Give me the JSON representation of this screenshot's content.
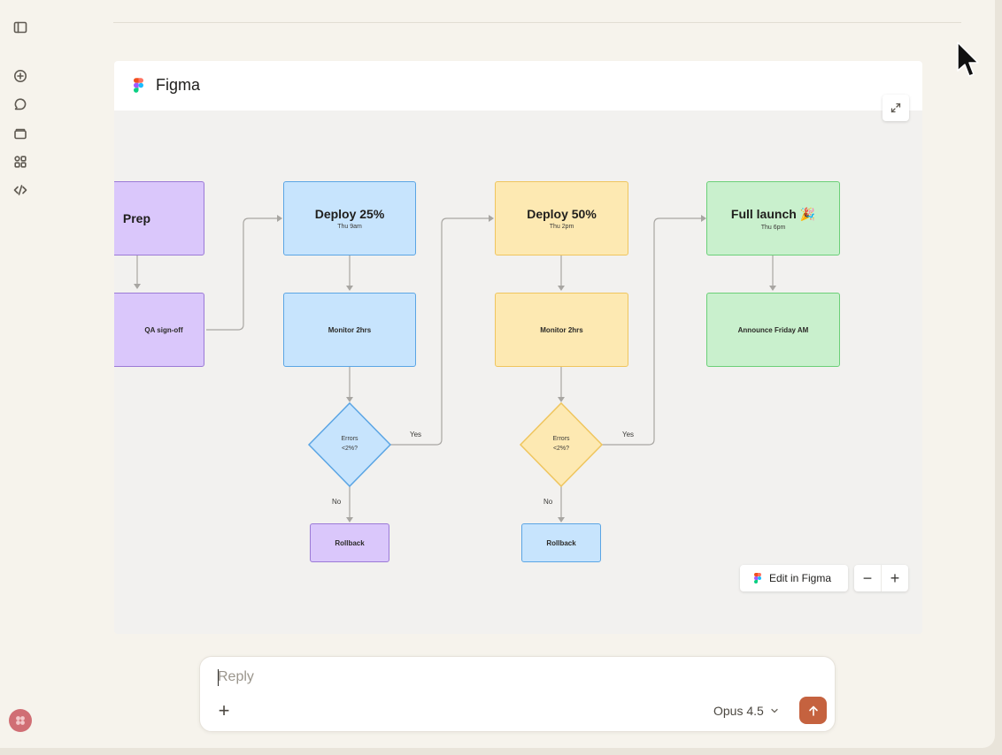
{
  "artifact": {
    "title": "Figma",
    "edit_label": "Edit in Figma",
    "zoom_out_label": "−",
    "zoom_in_label": "+"
  },
  "flowchart": {
    "prep": {
      "title": "Prep"
    },
    "qa": {
      "label": "QA sign-off"
    },
    "stage1": {
      "title": "Deploy 25%",
      "time": "Thu 9am",
      "monitor": "Monitor 2hrs",
      "decision_line1": "Errors",
      "decision_line2": "<2%?",
      "yes": "Yes",
      "no": "No",
      "rollback": "Rollback"
    },
    "stage2": {
      "title": "Deploy 50%",
      "time": "Thu 2pm",
      "monitor": "Monitor 2hrs",
      "decision_line1": "Errors",
      "decision_line2": "<2%?",
      "yes": "Yes",
      "no": "No",
      "rollback": "Rollback"
    },
    "stage3": {
      "title": "Full launch 🎉",
      "time": "Thu 6pm",
      "announce": "Announce Friday AM"
    }
  },
  "composer": {
    "placeholder": "Reply",
    "model": "Opus 4.5",
    "add_label": "+"
  },
  "colors": {
    "purple": "#dac7fb",
    "blue": "#c7e4fd",
    "yellow": "#fde9b2",
    "green": "#c9f0cd",
    "send": "#c5623f"
  },
  "sidebar": {
    "icons": [
      "sidebar-toggle-icon",
      "new-chat-icon",
      "chats-icon",
      "projects-icon",
      "artifacts-icon",
      "code-icon"
    ]
  }
}
